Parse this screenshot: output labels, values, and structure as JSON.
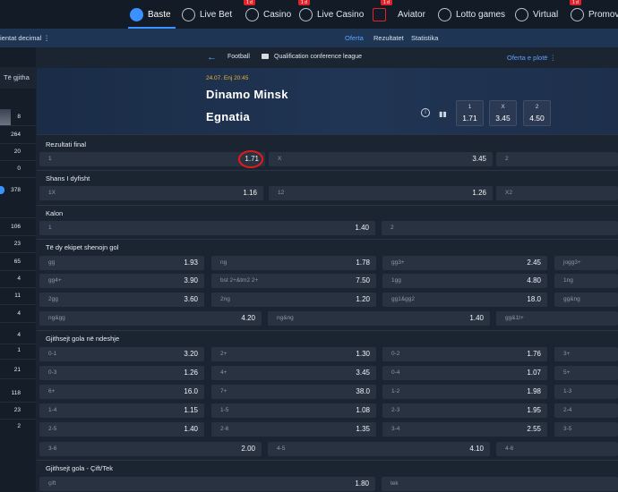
{
  "nav": {
    "items": [
      {
        "label": "Baste",
        "icon": "soccer-ball-icon",
        "active": true
      },
      {
        "label": "Live Bet",
        "icon": "live-bet-icon"
      },
      {
        "label": "Casino",
        "icon": "casino-icon"
      },
      {
        "label": "Live Casino",
        "icon": "live-casino-icon"
      },
      {
        "label": "Aviator",
        "icon": "aviator-plane-icon"
      },
      {
        "label": "Lotto games",
        "icon": "lotto-icon"
      },
      {
        "label": "Virtual",
        "icon": "virtual-icon"
      },
      {
        "label": "Promovi",
        "icon": "promo-icon"
      }
    ],
    "badge_text": "1 d"
  },
  "subnav": {
    "orientation_label": "ientat decimal ⋮",
    "tabs": [
      "Oferta",
      "Rezultatet",
      "Statistika"
    ],
    "active_tab": "Oferta"
  },
  "sidebar": {
    "search_label": "Të gjitha",
    "counts": [
      "8",
      "264",
      "20",
      "0",
      "378",
      "106",
      "23",
      "65",
      "4",
      "11",
      "4",
      "4",
      "1",
      "21",
      "118",
      "23",
      "2"
    ]
  },
  "match": {
    "breadcrumb": {
      "sport": "Football",
      "league": "Qualification conference league"
    },
    "offer_all": "Oferta e plotë ⋮",
    "date": "24.07. Enj 20:45",
    "home": "Dinamo Minsk",
    "away": "Egnatia",
    "odds_1x2": [
      {
        "label": "1",
        "value": "1.71"
      },
      {
        "label": "X",
        "value": "3.45"
      },
      {
        "label": "2",
        "value": "4.50"
      }
    ]
  },
  "markets": {
    "rezultati_final": {
      "title": "Rezultati final",
      "cells": [
        {
          "label": "1",
          "odd": "1.71"
        },
        {
          "label": "X",
          "odd": "3.45"
        },
        {
          "label": "2",
          "odd": ""
        }
      ]
    },
    "shans_i_dyfisht": {
      "title": "Shans I dyfisht",
      "cells": [
        {
          "label": "1X",
          "odd": "1.16"
        },
        {
          "label": "12",
          "odd": "1.26"
        },
        {
          "label": "X2",
          "odd": ""
        }
      ]
    },
    "kalon": {
      "title": "Kalon",
      "cells": [
        {
          "label": "1",
          "odd": "1.40"
        },
        {
          "label": "2",
          "odd": ""
        }
      ]
    },
    "te_dy_ekipet": {
      "title": "Të dy ekipet shenojn gol",
      "rows": [
        [
          {
            "label": "gg",
            "odd": "1.93"
          },
          {
            "label": "ng",
            "odd": "1.78"
          },
          {
            "label": "gg3+",
            "odd": "2.45"
          },
          {
            "label": "jogg3+",
            "odd": ""
          }
        ],
        [
          {
            "label": "gg4+",
            "odd": "3.90"
          },
          {
            "label": "bst 2+&tm2 2+",
            "odd": "7.50"
          },
          {
            "label": "1gg",
            "odd": "4.80"
          },
          {
            "label": "1ng",
            "odd": ""
          }
        ],
        [
          {
            "label": "2gg",
            "odd": "3.60"
          },
          {
            "label": "2ng",
            "odd": "1.20"
          },
          {
            "label": "gg1&gg2",
            "odd": "18.0"
          },
          {
            "label": "gg&ng",
            "odd": ""
          }
        ],
        [
          {
            "label": "ng&gg",
            "odd": "4.20"
          },
          {
            "label": "ng&ng",
            "odd": "1.40"
          },
          {
            "label": "gg&1t+",
            "odd": ""
          }
        ]
      ]
    },
    "gjithsejt_gola": {
      "title": "Gjithsejt gola në ndeshje",
      "rows": [
        [
          {
            "label": "0-1",
            "odd": "3.20"
          },
          {
            "label": "2+",
            "odd": "1.30"
          },
          {
            "label": "0-2",
            "odd": "1.76"
          },
          {
            "label": "3+",
            "odd": ""
          }
        ],
        [
          {
            "label": "0-3",
            "odd": "1.26"
          },
          {
            "label": "4+",
            "odd": "3.45"
          },
          {
            "label": "0-4",
            "odd": "1.07"
          },
          {
            "label": "5+",
            "odd": ""
          }
        ],
        [
          {
            "label": "6+",
            "odd": "16.0"
          },
          {
            "label": "7+",
            "odd": "38.0"
          },
          {
            "label": "1-2",
            "odd": "1.98"
          },
          {
            "label": "1-3",
            "odd": ""
          }
        ],
        [
          {
            "label": "1-4",
            "odd": "1.15"
          },
          {
            "label": "1-5",
            "odd": "1.08"
          },
          {
            "label": "2-3",
            "odd": "1.95"
          },
          {
            "label": "2-4",
            "odd": ""
          }
        ],
        [
          {
            "label": "2-5",
            "odd": "1.40"
          },
          {
            "label": "2-6",
            "odd": "1.35"
          },
          {
            "label": "3-4",
            "odd": "2.55"
          },
          {
            "label": "3-5",
            "odd": ""
          }
        ],
        [
          {
            "label": "3-6",
            "odd": "2.00"
          },
          {
            "label": "4-5",
            "odd": "4.10"
          },
          {
            "label": "4-6",
            "odd": ""
          }
        ]
      ]
    },
    "cift_tek": {
      "title": "Gjithsejt gola - Çift/Tek",
      "cells": [
        {
          "label": "çift",
          "odd": "1.80"
        },
        {
          "label": "tek",
          "odd": ""
        }
      ]
    }
  },
  "colors": {
    "accent": "#3b91ff",
    "highlight_circle": "#e11b1b",
    "date": "#f2b233"
  }
}
